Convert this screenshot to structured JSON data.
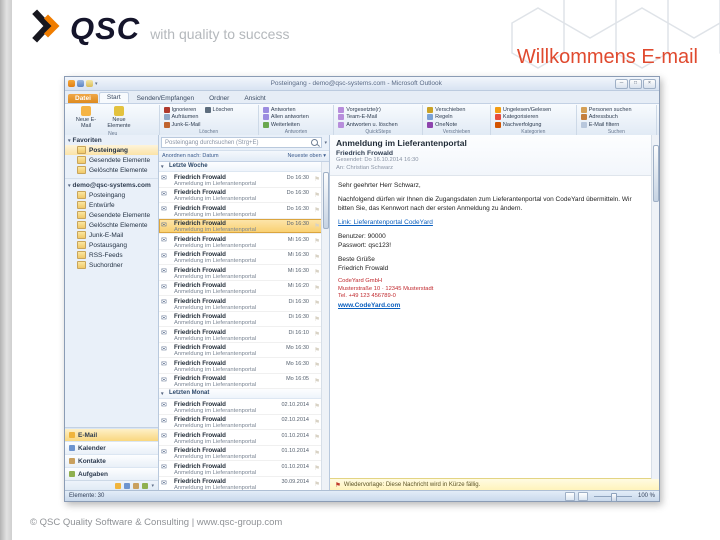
{
  "icons": {
    "envelope": "✉",
    "flag": "⚑",
    "warning_flag": "⚑",
    "triangle_down": "▾",
    "triangle_right": "▸",
    "dropdown_arrow": "▾",
    "minimize": "─",
    "maximize": "□",
    "close": "×"
  },
  "slide": {
    "logo_text": "QSC",
    "logo_tagline": "with quality to success",
    "title": "Willkommens E-mail",
    "footer": "© QSC Quality Software & Consulting | www.qsc-group.com"
  },
  "outlook": {
    "window_title": "Posteingang - demo@qsc-systems.com - Microsoft Outlook",
    "ribbon": {
      "tabs": [
        {
          "label": "Datei",
          "type": "file"
        },
        {
          "label": "Start",
          "active": true
        },
        {
          "label": "Senden/Empfangen"
        },
        {
          "label": "Ordner"
        },
        {
          "label": "Ansicht"
        }
      ],
      "groups": [
        {
          "label": "Neu",
          "large": true,
          "buttons": [
            {
              "label": "Neue E-Mail",
              "icon": "new-email-icon"
            },
            {
              "label": "Neue Elemente",
              "icon": "new-items-icon"
            }
          ]
        },
        {
          "label": "Löschen",
          "buttons": [
            {
              "label": "Ignorieren",
              "icon": "ignore-icon"
            },
            {
              "label": "Aufräumen",
              "icon": "cleanup-icon"
            },
            {
              "label": "Junk-E-Mail",
              "icon": "junk-icon"
            },
            {
              "label": "Löschen",
              "icon": "delete-icon"
            }
          ]
        },
        {
          "label": "Antworten",
          "buttons": [
            {
              "label": "Antworten",
              "icon": "reply-icon"
            },
            {
              "label": "Allen antworten",
              "icon": "reply-all-icon"
            },
            {
              "label": "Weiterleiten",
              "icon": "forward-icon"
            }
          ]
        },
        {
          "label": "QuickSteps",
          "buttons": [
            {
              "label": "Vorgesetzte(r)",
              "icon": "quickstep-icon"
            },
            {
              "label": "Team-E-Mail",
              "icon": "quickstep-icon"
            },
            {
              "label": "Antworten u. löschen",
              "icon": "quickstep-icon"
            }
          ]
        },
        {
          "label": "Verschieben",
          "buttons": [
            {
              "label": "Verschieben",
              "icon": "move-icon"
            },
            {
              "label": "Regeln",
              "icon": "rules-icon"
            },
            {
              "label": "OneNote",
              "icon": "onenote-icon"
            }
          ]
        },
        {
          "label": "Kategorien",
          "buttons": [
            {
              "label": "Ungelesen/Gelesen",
              "icon": "unread-icon"
            },
            {
              "label": "Kategorisieren",
              "icon": "categorize-icon"
            },
            {
              "label": "Nachverfolgung",
              "icon": "followup-icon"
            }
          ]
        },
        {
          "label": "Suchen",
          "buttons": [
            {
              "label": "Personen suchen",
              "icon": "find-people-icon"
            },
            {
              "label": "Adressbuch",
              "icon": "address-book-icon"
            },
            {
              "label": "E-Mail filtern",
              "icon": "filter-email-icon"
            }
          ]
        }
      ]
    },
    "folderPane": {
      "favorites_header": "Favoriten",
      "favorites": [
        {
          "label": "Posteingang",
          "selected": true
        },
        {
          "label": "Gesendete Elemente"
        },
        {
          "label": "Gelöschte Elemente"
        }
      ],
      "account": "demo@qsc-systems.com",
      "account_folders": [
        {
          "label": "Posteingang"
        },
        {
          "label": "Entwürfe"
        },
        {
          "label": "Gesendete Elemente"
        },
        {
          "label": "Gelöschte Elemente"
        },
        {
          "label": "Junk-E-Mail"
        },
        {
          "label": "Postausgang"
        },
        {
          "label": "RSS-Feeds"
        },
        {
          "label": "Suchordner"
        }
      ],
      "nav": [
        {
          "label": "E-Mail",
          "active": true,
          "icon": "mail-nav-icon"
        },
        {
          "label": "Kalender",
          "icon": "calendar-nav-icon"
        },
        {
          "label": "Kontakte",
          "icon": "contacts-nav-icon"
        },
        {
          "label": "Aufgaben",
          "icon": "tasks-nav-icon"
        }
      ]
    },
    "mailList": {
      "search_placeholder": "Posteingang durchsuchen (Strg+E)",
      "sort_by": "Anordnen nach: Datum",
      "sort_dir": "Neueste oben",
      "groups": [
        {
          "label": "Letzte Woche",
          "items": [
            {
              "sender": "Friedrich Frowald",
              "subject": "Anmeldung im Lieferantenportal",
              "time": "Do 16:30"
            },
            {
              "sender": "Friedrich Frowald",
              "subject": "Anmeldung im Lieferantenportal",
              "time": "Do 16:30"
            },
            {
              "sender": "Friedrich Frowald",
              "subject": "Anmeldung im Lieferantenportal",
              "time": "Do 16:30"
            },
            {
              "sender": "Friedrich Frowald",
              "subject": "Anmeldung im Lieferantenportal",
              "time": "Do 16:30",
              "selected": true
            },
            {
              "sender": "Friedrich Frowald",
              "subject": "Anmeldung im Lieferantenportal",
              "time": "Mi 16:30"
            },
            {
              "sender": "Friedrich Frowald",
              "subject": "Anmeldung im Lieferantenportal",
              "time": "Mi 16:30"
            },
            {
              "sender": "Friedrich Frowald",
              "subject": "Anmeldung im Lieferantenportal",
              "time": "Mi 16:30"
            },
            {
              "sender": "Friedrich Frowald",
              "subject": "Anmeldung im Lieferantenportal",
              "time": "Mi 16:20"
            },
            {
              "sender": "Friedrich Frowald",
              "subject": "Anmeldung im Lieferantenportal",
              "time": "Di 16:30"
            },
            {
              "sender": "Friedrich Frowald",
              "subject": "Anmeldung im Lieferantenportal",
              "time": "Di 16:30"
            },
            {
              "sender": "Friedrich Frowald",
              "subject": "Anmeldung im Lieferantenportal",
              "time": "Di 16:10"
            },
            {
              "sender": "Friedrich Frowald",
              "subject": "Anmeldung im Lieferantenportal",
              "time": "Mo 16:30"
            },
            {
              "sender": "Friedrich Frowald",
              "subject": "Anmeldung im Lieferantenportal",
              "time": "Mo 16:30"
            },
            {
              "sender": "Friedrich Frowald",
              "subject": "Anmeldung im Lieferantenportal",
              "time": "Mo 16:05"
            }
          ]
        },
        {
          "label": "Letzten Monat",
          "items": [
            {
              "sender": "Friedrich Frowald",
              "subject": "Anmeldung im Lieferantenportal",
              "time": "02.10.2014"
            },
            {
              "sender": "Friedrich Frowald",
              "subject": "Anmeldung im Lieferantenportal",
              "time": "02.10.2014"
            },
            {
              "sender": "Friedrich Frowald",
              "subject": "Anmeldung im Lieferantenportal",
              "time": "01.10.2014"
            },
            {
              "sender": "Friedrich Frowald",
              "subject": "Anmeldung im Lieferantenportal",
              "time": "01.10.2014"
            },
            {
              "sender": "Friedrich Frowald",
              "subject": "Anmeldung im Lieferantenportal",
              "time": "01.10.2014"
            },
            {
              "sender": "Friedrich Frowald",
              "subject": "Anmeldung im Lieferantenportal",
              "time": "30.09.2014"
            }
          ]
        }
      ]
    },
    "reading": {
      "subject": "Anmeldung im Lieferantenportal",
      "sender": "Friedrich Frowald",
      "sent_line": "Gesendet: Do 16.10.2014 16:30",
      "to_line": "An: Christian Schwarz",
      "info_bar": "Wiedervorlage: Diese Nachricht wird in Kürze fällig.",
      "body": [
        {
          "style": "text",
          "text": "Sehr geehrter Herr Schwarz,"
        },
        {
          "style": "gap"
        },
        {
          "style": "text",
          "text": "Nachfolgend dürfen wir Ihnen die Zugangsdaten zum Lieferantenportal von CodeYard übermitteln. Wir bitten Sie, das Kennwort nach der ersten Anmeldung zu ändern."
        },
        {
          "style": "gap"
        },
        {
          "style": "link",
          "text": "Link: Lieferantenportal CodeYard"
        },
        {
          "style": "gap"
        },
        {
          "style": "text",
          "text": "Benutzer: 90000"
        },
        {
          "style": "text",
          "text": "Passwort: qsc123!"
        },
        {
          "style": "gap"
        },
        {
          "style": "text",
          "text": "Beste Grüße"
        },
        {
          "style": "text",
          "text": "Friedrich Frowald"
        },
        {
          "style": "gap"
        },
        {
          "style": "red",
          "text": "CodeYard GmbH"
        },
        {
          "style": "red",
          "text": "Musterstraße 10 · 12345 Musterstadt"
        },
        {
          "style": "red",
          "text": "Tel. +49 123 456789-0"
        },
        {
          "style": "linkbold",
          "text": "www.CodeYard.com"
        }
      ]
    },
    "statusbar": {
      "left": "Elemente: 30",
      "zoom": "100 %"
    }
  }
}
